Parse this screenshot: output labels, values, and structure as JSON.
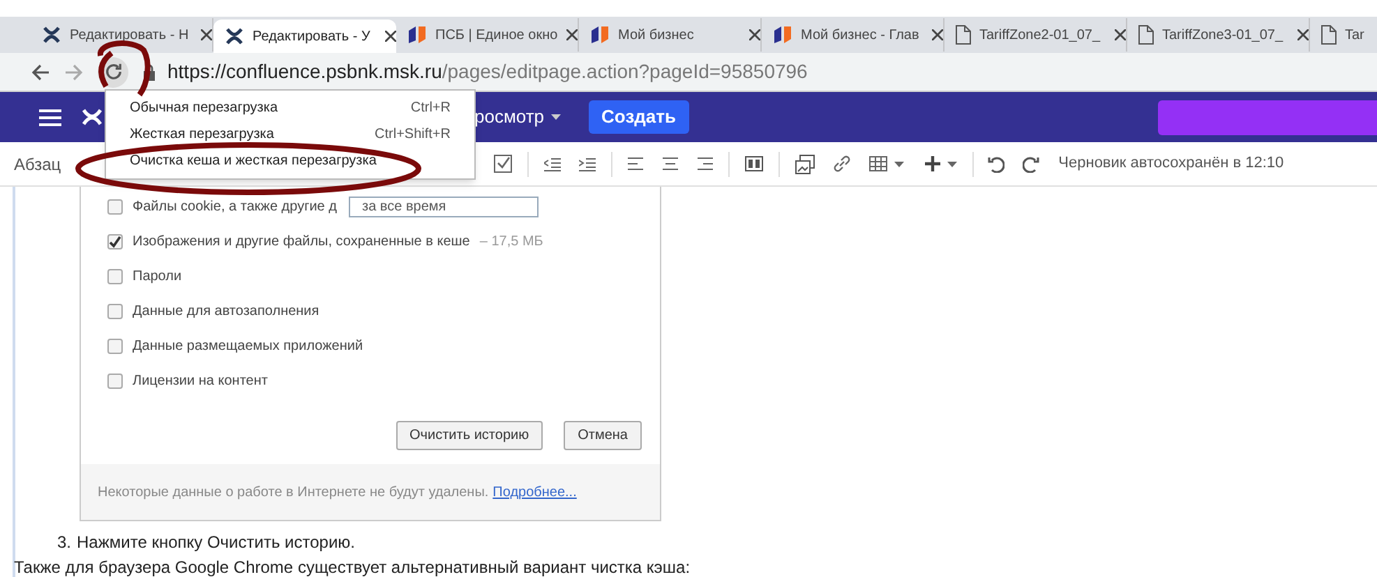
{
  "tabs": [
    {
      "title": "Редактировать - Н",
      "kind": "wiki",
      "selected": false
    },
    {
      "title": "Редактировать - У",
      "kind": "wiki",
      "selected": true
    },
    {
      "title": "ПСБ | Единое окно",
      "kind": "bank",
      "selected": false
    },
    {
      "title": "Мой бизнес",
      "kind": "bank",
      "selected": false
    },
    {
      "title": "Мой бизнес - Глав",
      "kind": "bank",
      "selected": false
    },
    {
      "title": "TariffZone2-01_07_",
      "kind": "file",
      "selected": false
    },
    {
      "title": "TariffZone3-01_07_",
      "kind": "file",
      "selected": false
    },
    {
      "title": "Tar",
      "kind": "file",
      "selected": false
    }
  ],
  "address_bar": {
    "url_host": "https://confluence.psbnk.msk.ru",
    "url_path": "/pages/editpage.action?pageId=95850796",
    "reload_circled": true
  },
  "reload_menu": {
    "items": [
      {
        "label": "Обычная перезагрузка",
        "shortcut": "Ctrl+R",
        "circled": false
      },
      {
        "label": "Жесткая перезагрузка",
        "shortcut": "Ctrl+Shift+R",
        "circled": false
      },
      {
        "label": "Очистка кеша и жесткая перезагрузка",
        "circled": true
      }
    ]
  },
  "header": {
    "view_menu": "росмотр",
    "create_button": "Создать"
  },
  "toolbar": {
    "paragraph_style": "Абзац",
    "autosave_status": "Черновик автосохранён в 12:10"
  },
  "clear_history_dialog": {
    "time_range": "за все время",
    "options": [
      {
        "label": "Файлы cookie, а также другие д",
        "checked": false
      },
      {
        "label": "Изображения и другие файлы, сохраненные в кеше",
        "size": "– 17,5 МБ",
        "checked": true
      },
      {
        "label": "Пароли",
        "checked": false
      },
      {
        "label": "Данные для автозаполнения",
        "checked": false
      },
      {
        "label": "Данные размещаемых приложений",
        "checked": false
      },
      {
        "label": "Лицензии на контент",
        "checked": false
      }
    ],
    "buttons": [
      "Очистить историю",
      "Отмена"
    ],
    "footer_text": "Некоторые данные о работе в Интернете не будут удалены.",
    "footer_link": "Подробнее..."
  },
  "steps": [
    {
      "number": "3.",
      "text": "Нажмите кнопку Очистить историю."
    }
  ],
  "paragraph": "Также для браузера Google Chrome существует альтернативный вариант чистка кэша:"
}
